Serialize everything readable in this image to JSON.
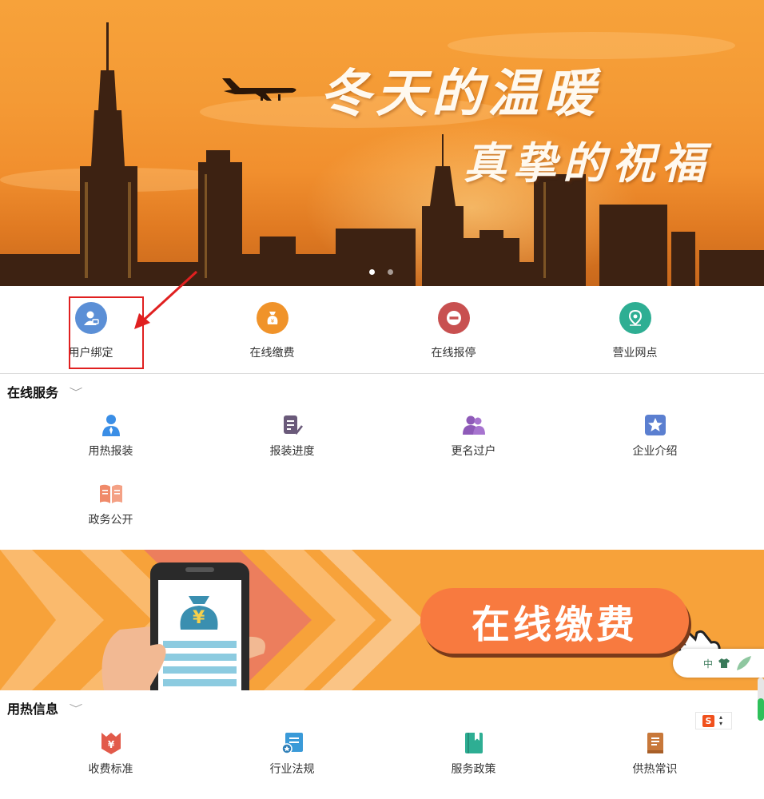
{
  "banner": {
    "headline_line1": "冬天的温暖",
    "headline_line2": "真挚的祝福",
    "carousel_dots": 2
  },
  "quick_entries": [
    {
      "label": "用户绑定",
      "icon": "user-bind-icon",
      "color": "#5b8fd6"
    },
    {
      "label": "在线缴费",
      "icon": "money-bag-icon",
      "color": "#f0932a"
    },
    {
      "label": "在线报停",
      "icon": "stop-icon",
      "color": "#c85050"
    },
    {
      "label": "营业网点",
      "icon": "location-pin-icon",
      "color": "#2eae93"
    }
  ],
  "online_services": {
    "title": "在线服务",
    "items": [
      {
        "label": "用热报装",
        "icon": "person-tie-icon",
        "color": "#3a8ee6"
      },
      {
        "label": "报装进度",
        "icon": "progress-doc-icon",
        "color": "#6a5a7a"
      },
      {
        "label": "更名过户",
        "icon": "users-transfer-icon",
        "color": "#8e5ab8"
      },
      {
        "label": "企业介绍",
        "icon": "star-icon",
        "color": "#5b7fd0"
      },
      {
        "label": "政务公开",
        "icon": "open-book-icon",
        "color": "#f08a6a"
      }
    ]
  },
  "promo": {
    "cta_text": "在线缴费",
    "currency_symbol": "¥"
  },
  "heat_info": {
    "title": "用热信息",
    "items": [
      {
        "label": "收费标准",
        "icon": "fee-standard-icon",
        "color": "#e25a4a"
      },
      {
        "label": "行业法规",
        "icon": "regulation-icon",
        "color": "#3a9ad8"
      },
      {
        "label": "服务政策",
        "icon": "policy-book-icon",
        "color": "#2eae93"
      },
      {
        "label": "供热常识",
        "icon": "knowledge-book-icon",
        "color": "#c8783a"
      }
    ]
  },
  "widgets": {
    "skin_label": "中",
    "ime_label": "S"
  }
}
